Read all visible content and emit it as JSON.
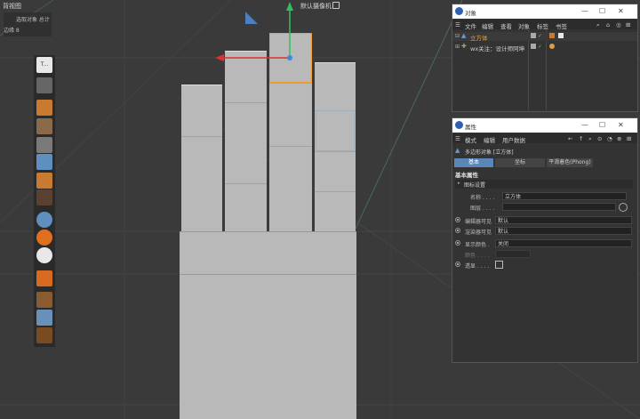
{
  "viewport": {
    "title": "背视图",
    "info_line1": "选取对象 总计",
    "info_line2": "边缘 8",
    "camera_label": "默认摄像机"
  },
  "objects_window": {
    "title": "对象",
    "menu": [
      "文件",
      "编辑",
      "查看",
      "对象",
      "标签",
      "书签"
    ],
    "rows": [
      {
        "name": "立方体",
        "selected": true
      },
      {
        "name": "wx关注：设计师阿坤",
        "selected": false
      }
    ]
  },
  "attributes_window": {
    "title": "属性",
    "menu": [
      "模式",
      "编辑",
      "用户数据"
    ],
    "object_header": "多边形对象 [立方体]",
    "tabs": [
      "基本",
      "坐标",
      "平滑着色(Phong)"
    ],
    "active_tab": "基本",
    "section_title": "基本属性",
    "subsection": "图标设置",
    "fields": [
      {
        "label": "名称 . . . .",
        "value": "立方体"
      },
      {
        "label": "图层 . . . .",
        "value": ""
      },
      {
        "label": "编辑器可见",
        "value": "默认"
      },
      {
        "label": "渲染器可见",
        "value": "默认"
      },
      {
        "label": "显示颜色 .",
        "value": "关闭"
      },
      {
        "label": "颜色 . . . .",
        "value": ""
      },
      {
        "label": "透显 . . . .",
        "value": ""
      }
    ]
  },
  "colors": {
    "accent_blue": "#4a7fc0",
    "selection_orange": "#f0a030",
    "axis_red": "#e03030",
    "axis_green": "#30c060"
  }
}
